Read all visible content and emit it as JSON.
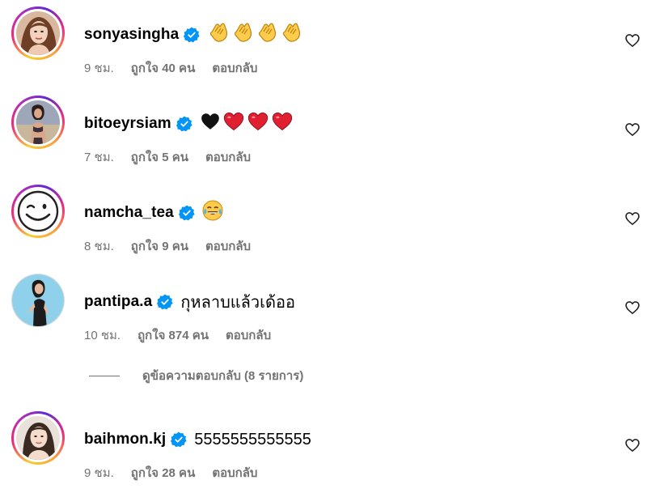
{
  "comments": [
    {
      "username": "sonyasingha",
      "text": "",
      "emojis": [
        "clap",
        "clap",
        "clap",
        "clap"
      ],
      "time": "9 ชม.",
      "likes": "ถูกใจ 40 คน",
      "reply": "ตอบกลับ",
      "verified": true,
      "avatar_ring": "story-gradient"
    },
    {
      "username": "bitoeyrsiam",
      "text": "",
      "emojis": [
        "black-heart",
        "red-heart",
        "red-heart",
        "red-heart"
      ],
      "time": "7 ชม.",
      "likes": "ถูกใจ 5 คน",
      "reply": "ตอบกลับ",
      "verified": true,
      "avatar_ring": "story-gradient"
    },
    {
      "username": "namcha_tea",
      "text": "",
      "emojis": [
        "joy"
      ],
      "time": "8 ชม.",
      "likes": "ถูกใจ 9 คน",
      "reply": "ตอบกลับ",
      "verified": true,
      "avatar_ring": "story-gradient"
    },
    {
      "username": "pantipa.a",
      "text": "กุหลาบแล้วเด้ออ",
      "emojis": [],
      "time": "10 ชม.",
      "likes": "ถูกใจ 874 คน",
      "reply": "ตอบกลับ",
      "verified": true,
      "avatar_ring": "plain"
    },
    {
      "username": "baihmon.kj",
      "text": "5555555555555",
      "emojis": [],
      "time": "9 ชม.",
      "likes": "ถูกใจ 28 คน",
      "reply": "ตอบกลับ",
      "verified": true,
      "avatar_ring": "story-gradient"
    }
  ],
  "view_replies": {
    "label": "ดูข้อความตอบกลับ (8 รายการ)"
  },
  "colors": {
    "verified": "#0095f6",
    "secondary_text": "#737373",
    "primary_text": "#000000",
    "like_icon": "#262626"
  },
  "icons": {
    "verified": "verified-badge-icon",
    "like": "heart-outline-icon"
  }
}
